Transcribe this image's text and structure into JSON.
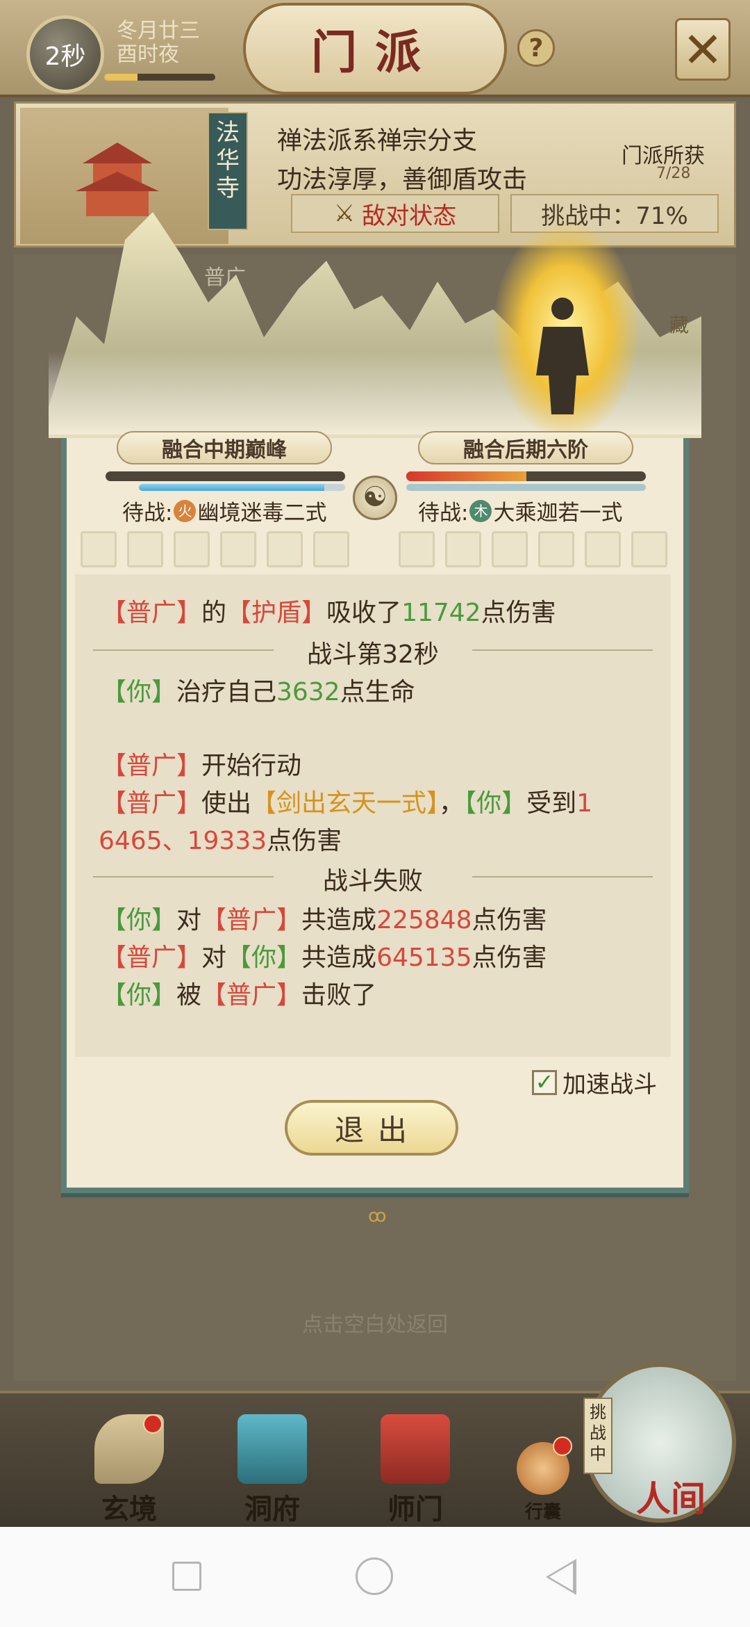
{
  "header": {
    "timer": "2秒",
    "date_line1": "冬月廿三",
    "date_line2": "酉时夜",
    "title": "门派",
    "help": "?"
  },
  "sect": {
    "name": "法华寺",
    "description_1": "禅法派系禅宗分支",
    "description_2": "功法淳厚，善御盾攻击",
    "loot_label": "门派所获",
    "loot_count": "7/28",
    "hostile_label": "敌对状态",
    "challenge_label": "挑战中：71%"
  },
  "battle": {
    "boss_name": "普广",
    "side_label": "藏",
    "left": {
      "realm": "融合中期巅峰",
      "pending_label": "待战:",
      "element": "火",
      "pending_skill": "幽境迷毒二式",
      "hp_fraction": 0.0,
      "mp_fraction": 0.9
    },
    "right": {
      "realm": "融合后期六阶",
      "pending_label": "待战:",
      "element": "木",
      "pending_skill": "大乘迦若一式",
      "hp_fraction": 0.5,
      "mp_fraction": 1.0
    }
  },
  "log": {
    "l1": {
      "a": "【普广】",
      "b": "的",
      "c": "【护盾】",
      "d": "吸收了",
      "e": "11742",
      "f": "点伤害"
    },
    "divider1": "战斗第32秒",
    "l2": {
      "a": "【你】",
      "b": "治疗自己",
      "c": "3632",
      "d": "点生命"
    },
    "l3": {
      "a": "【普广】",
      "b": "开始行动"
    },
    "l4": {
      "a": "【普广】",
      "b": "使出",
      "c": "【剑出玄天一式】",
      "d": "，",
      "e": "【你】",
      "f": "受到",
      "g": "1"
    },
    "l5": {
      "a": "6465、19333",
      "b": "点伤害"
    },
    "divider2": "战斗失败",
    "l6": {
      "a": "【你】",
      "b": "对",
      "c": "【普广】",
      "d": "共造成",
      "e": "225848",
      "f": "点伤害"
    },
    "l7": {
      "a": "【普广】",
      "b": "对",
      "c": "【你】",
      "d": "共造成",
      "e": "645135",
      "f": "点伤害"
    },
    "l8": {
      "a": "【你】",
      "b": "被",
      "c": "【普广】",
      "d": "击败了"
    }
  },
  "controls": {
    "speed_label": "加速战斗",
    "speed_checked": true,
    "exit_label": "退出",
    "background_hint": "点击空白处返回"
  },
  "nav": {
    "xuanjing": "玄境",
    "dongfu": "洞府",
    "shimen": "师门",
    "bag": "行囊",
    "renjian": "人间",
    "challenge_tag": "挑战中"
  }
}
